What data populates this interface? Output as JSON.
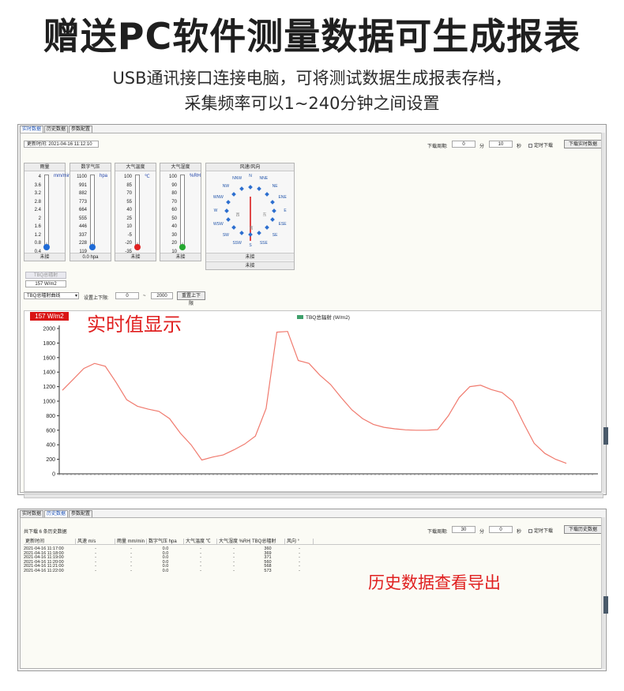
{
  "banner": {
    "title": "赠送PC软件测量数据可生成报表",
    "line1": "USB通讯接口连接电脑，可将测试数据生成报表存档，",
    "line2": "采集频率可以1~240分钟之间设置"
  },
  "callouts": {
    "realtime": "实时值显示",
    "history": "历史数据查看导出"
  },
  "window1": {
    "tabs": [
      "实时数据",
      "历史数据",
      "参数配置"
    ],
    "update_time_label": "更新时间: 2021-04-16 11:12:10",
    "download_period_label": "下载周期:",
    "minutes_value": "0",
    "minutes_unit": "分",
    "seconds_value": "10",
    "seconds_unit": "秒",
    "timed_download_label": "定时下载",
    "download_button": "下载实时数据",
    "gauges": [
      {
        "title": "雨量",
        "unit": "mm/min",
        "ticks": [
          "4",
          "3.6",
          "3.2",
          "2.8",
          "2.4",
          "2",
          "1.6",
          "1.2",
          "0.8",
          "0.4",
          "0"
        ],
        "footer": "未接",
        "bulb_color": "#1e6ad6"
      },
      {
        "title": "数字气压",
        "unit": "hpa",
        "ticks": [
          "1100",
          "991",
          "882",
          "773",
          "664",
          "555",
          "446",
          "337",
          "228",
          "119",
          "10"
        ],
        "footer": "0.0 hpa",
        "bulb_color": "#1e6ad6"
      },
      {
        "title": "大气温度",
        "unit": "℃",
        "ticks": [
          "100",
          "85",
          "70",
          "55",
          "40",
          "25",
          "10",
          "-5",
          "-20",
          "-35",
          "-50"
        ],
        "footer": "未接",
        "bulb_color": "#e02020"
      },
      {
        "title": "大气湿度",
        "unit": "%RH",
        "ticks": [
          "100",
          "90",
          "80",
          "70",
          "60",
          "50",
          "40",
          "30",
          "20",
          "10",
          "0"
        ],
        "footer": "未接",
        "bulb_color": "#23a82f"
      }
    ],
    "wind": {
      "title": "风速/风向",
      "directions": [
        "N",
        "NNE",
        "NE",
        "ENE",
        "E",
        "ESE",
        "SE",
        "SSE",
        "S",
        "SSW",
        "SW",
        "WSW",
        "W",
        "WNW",
        "NW",
        "NNW"
      ],
      "center_left": "西",
      "center_right": "东",
      "center_bottom": "南",
      "footer1": "未接",
      "footer2": "未接"
    },
    "tbq_small_label": "TBQ总辐射",
    "tbq_value_box": "157 W/m2",
    "curve_select": "TBQ总辐射曲线",
    "range_label": "设置上下限:",
    "range_low": "0",
    "range_tilde": "~",
    "range_high": "2000",
    "reset_range_button": "重置上下限",
    "live_value": "157 W/m2"
  },
  "chart_data": {
    "type": "line",
    "legend": [
      "TBQ总辐射 (W/m2)"
    ],
    "legend_placement": "top-center",
    "ylim": [
      0,
      2000
    ],
    "yticks": [
      0,
      200,
      400,
      600,
      800,
      1000,
      1200,
      1400,
      1600,
      1800,
      2000
    ],
    "x_end_label": "T",
    "grid": false,
    "series": [
      {
        "name": "TBQ总辐射 (W/m2)",
        "color": "#f07a6e",
        "values": [
          1150,
          1300,
          1450,
          1520,
          1480,
          1260,
          1020,
          930,
          890,
          860,
          760,
          560,
          400,
          190,
          230,
          260,
          330,
          410,
          520,
          900,
          1950,
          1960,
          1560,
          1520,
          1360,
          1230,
          1050,
          880,
          760,
          680,
          640,
          620,
          605,
          600,
          600,
          610,
          800,
          1050,
          1200,
          1220,
          1160,
          1120,
          1000,
          700,
          420,
          280,
          200,
          145
        ]
      }
    ]
  },
  "window2": {
    "tabs": [
      "实时数据",
      "历史数据",
      "参数配置"
    ],
    "count_label": "共下载 6 条历史数据",
    "download_period_label": "下载周期:",
    "minutes_value": "30",
    "minutes_unit": "分",
    "seconds_value": "0",
    "seconds_unit": "秒",
    "timed_download_label": "定时下载",
    "download_button": "下载历史数据",
    "columns": [
      "更新时间",
      "风速 m/s",
      "雨量 mm/min",
      "数字气压 hpa",
      "大气温度 ℃",
      "大气湿度 %RH",
      "TBQ总辐射",
      "风向 °"
    ],
    "rows": [
      [
        "2021-04-16 11:17:00",
        "-",
        "-",
        "0.0",
        "-",
        "-",
        "360",
        "-"
      ],
      [
        "2021-04-16 11:18:00",
        "-",
        "-",
        "0.0",
        "-",
        "-",
        "369",
        "-"
      ],
      [
        "2021-04-16 11:19:00",
        "-",
        "-",
        "0.0",
        "-",
        "-",
        "371",
        "-"
      ],
      [
        "2021-04-16 11:20:00",
        "-",
        "-",
        "0.0",
        "-",
        "-",
        "560",
        "-"
      ],
      [
        "2021-04-16 11:21:00",
        "-",
        "-",
        "0.0",
        "-",
        "-",
        "568",
        "-"
      ],
      [
        "2021-04-16 11:22:00",
        "-",
        "-",
        "0.0",
        "-",
        "-",
        "573",
        "-"
      ]
    ]
  }
}
